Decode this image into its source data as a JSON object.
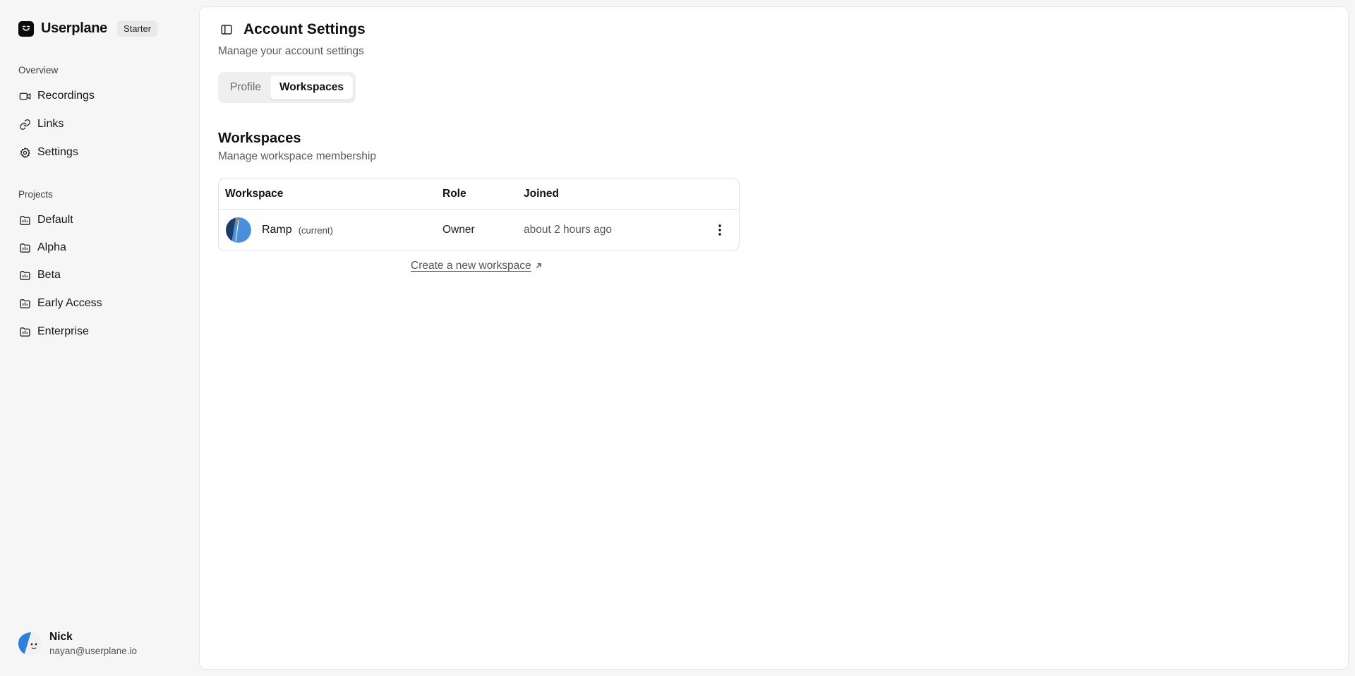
{
  "brand": {
    "name": "Userplane",
    "plan": "Starter"
  },
  "sidebar": {
    "overview_label": "Overview",
    "overview_items": [
      {
        "label": "Recordings",
        "icon": "video-camera-icon"
      },
      {
        "label": "Links",
        "icon": "link-icon"
      },
      {
        "label": "Settings",
        "icon": "gear-icon"
      }
    ],
    "projects_label": "Projects",
    "project_items": [
      {
        "label": "Default",
        "icon": "folder-icon"
      },
      {
        "label": "Alpha",
        "icon": "folder-icon"
      },
      {
        "label": "Beta",
        "icon": "folder-icon"
      },
      {
        "label": "Early Access",
        "icon": "folder-icon"
      },
      {
        "label": "Enterprise",
        "icon": "folder-icon"
      }
    ]
  },
  "user": {
    "name": "Nick",
    "email": "nayan@userplane.io"
  },
  "header": {
    "title": "Account Settings",
    "subtitle": "Manage your account settings"
  },
  "tabs": [
    {
      "label": "Profile",
      "active": false
    },
    {
      "label": "Workspaces",
      "active": true
    }
  ],
  "workspaces": {
    "title": "Workspaces",
    "subtitle": "Manage workspace membership",
    "columns": [
      "Workspace",
      "Role",
      "Joined"
    ],
    "rows": [
      {
        "name": "Ramp",
        "current_label": "(current)",
        "role": "Owner",
        "joined": "about 2 hours ago"
      }
    ],
    "create_link": "Create a new workspace"
  },
  "colors": {
    "page_background": "#f6f6f6",
    "panel_background": "#ffffff",
    "tab_track": "#efefef",
    "avatar_blue": "#4a8fdc"
  }
}
